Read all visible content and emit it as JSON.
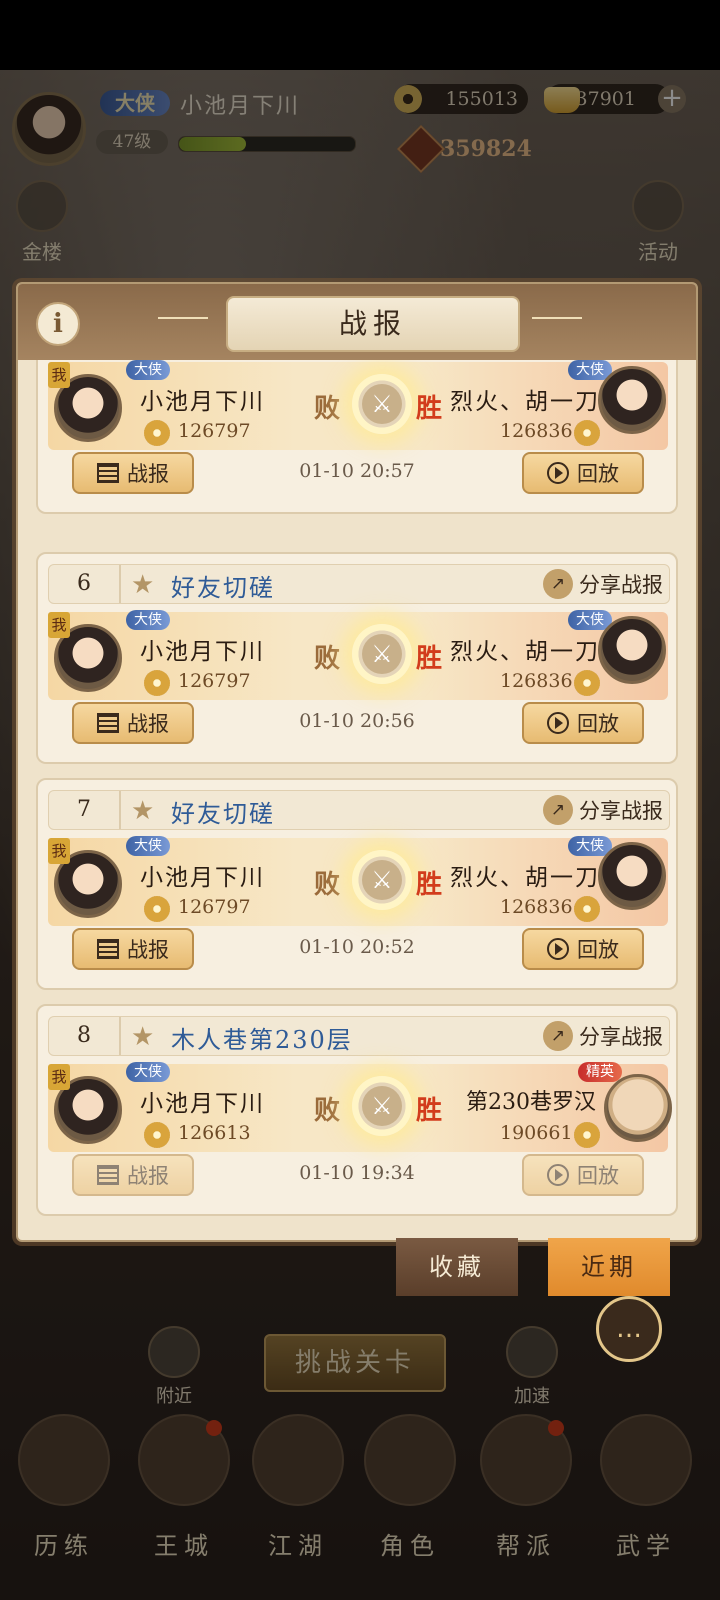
{
  "header": {
    "rank": "大侠",
    "player_name": "小池月下川",
    "level": "47级",
    "exp_fraction": 0.38,
    "copper": "155013",
    "gold": "37901",
    "power": "359824"
  },
  "side": {
    "left_label": "金楼",
    "right_label": "活动"
  },
  "dialog": {
    "title": "战报",
    "info_icon": "i",
    "report_label": "战报",
    "replay_label": "回放",
    "share_label": "分享战报",
    "lose_label": "败",
    "win_label": "胜",
    "me_label": "我"
  },
  "records": [
    {
      "index": "",
      "title": "",
      "left": {
        "rank": "大侠",
        "name": "小池月下川",
        "power": "126797"
      },
      "right": {
        "rank": "大侠",
        "name": "烈火、胡一刀",
        "power": "126836"
      },
      "time": "01-10 20:57"
    },
    {
      "index": "6",
      "title": "好友切磋",
      "left": {
        "rank": "大侠",
        "name": "小池月下川",
        "power": "126797"
      },
      "right": {
        "rank": "大侠",
        "name": "烈火、胡一刀",
        "power": "126836"
      },
      "time": "01-10 20:56"
    },
    {
      "index": "7",
      "title": "好友切磋",
      "left": {
        "rank": "大侠",
        "name": "小池月下川",
        "power": "126797"
      },
      "right": {
        "rank": "大侠",
        "name": "烈火、胡一刀",
        "power": "126836"
      },
      "time": "01-10 20:52"
    },
    {
      "index": "8",
      "title": "木人巷第230层",
      "left": {
        "rank": "大侠",
        "name": "小池月下川",
        "power": "126613"
      },
      "right": {
        "rank": "精英",
        "name": "第230巷罗汉",
        "power": "190661"
      },
      "time": "01-10 19:34"
    }
  ],
  "tabs": {
    "collect": "收藏",
    "recent": "近期"
  },
  "bottom": {
    "nearby": "附近",
    "challenge": "挑战关卡",
    "speedup": "加速"
  },
  "nav": [
    "历练",
    "王城",
    "江湖",
    "角色",
    "帮派",
    "武学"
  ]
}
